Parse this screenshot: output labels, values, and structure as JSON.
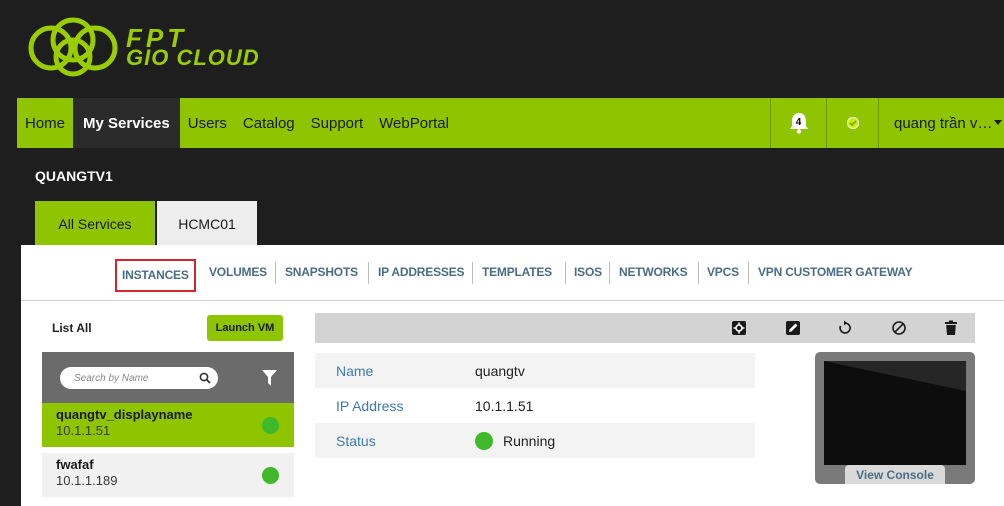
{
  "brand": {
    "logo_line1": "FPT",
    "logo_line2": "GIO CLOUD",
    "accent_color": "#8fc400"
  },
  "nav": {
    "items": [
      "Home",
      "My Services",
      "Users",
      "Catalog",
      "Support",
      "WebPortal"
    ],
    "active": "My Services",
    "notifications_count": "4",
    "user": "quang trần v…"
  },
  "account": {
    "name": "QUANGTV1"
  },
  "tabs": {
    "all_services": "All Services",
    "zone": "HCMC01",
    "active": "All Services"
  },
  "subnav": {
    "items": [
      "INSTANCES",
      "VOLUMES",
      "SNAPSHOTS",
      "IP ADDRESSES",
      "TEMPLATES",
      "ISOS",
      "NETWORKS",
      "VPCS",
      "VPN CUSTOMER GATEWAY"
    ],
    "selected": "INSTANCES"
  },
  "sidebar": {
    "list_all": "List All",
    "launch_label": "Launch VM",
    "search_placeholder": "Search by Name",
    "vms": [
      {
        "name": "quangtv_displayname",
        "ip": "10.1.1.51",
        "selected": true,
        "status_color": "#3fb92a"
      },
      {
        "name": "fwafaf",
        "ip": "10.1.1.189",
        "selected": false,
        "status_color": "#3fb92a"
      }
    ]
  },
  "toolbar": {
    "icons": [
      "settings-icon",
      "edit-icon",
      "reboot-icon",
      "stop-icon",
      "delete-icon"
    ]
  },
  "detail": {
    "name_label": "Name",
    "name_value": "quangtv",
    "ip_label": "IP Address",
    "ip_value": "10.1.1.51",
    "status_label": "Status",
    "status_value": "Running",
    "status_color": "#3fb92a"
  },
  "console": {
    "button_label": "View Console"
  }
}
